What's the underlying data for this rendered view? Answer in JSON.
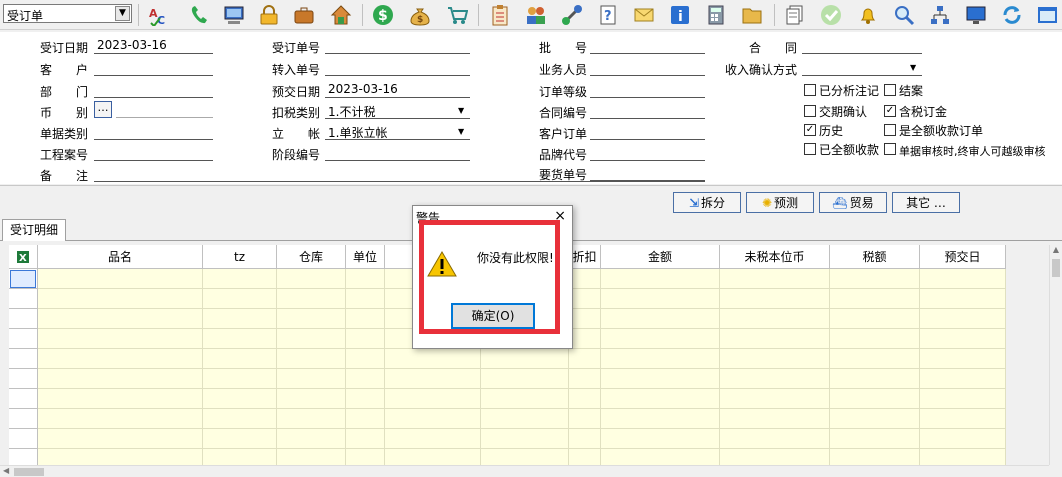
{
  "toolbar": {
    "form_select": "受订单",
    "icons": [
      "spell-check-icon",
      "phone-icon",
      "computer-icon",
      "lock-icon",
      "briefcase-icon",
      "home-icon",
      "dollar-icon",
      "money-bag-icon",
      "cart-icon",
      "clipboard-icon",
      "users-icon",
      "link-icon",
      "help-doc-icon",
      "mail-icon",
      "info-icon",
      "calculator-icon",
      "folder-icon",
      "document-icon",
      "check-icon",
      "bell-icon",
      "search-icon",
      "tree-icon",
      "monitor-icon",
      "refresh-icon",
      "window-icon"
    ]
  },
  "form": {
    "order_date_label": "受订日期",
    "order_date": "2023-03-16",
    "customer_label": "客　　户",
    "dept_label": "部　　门",
    "currency_label": "币　　别",
    "currency_btn": "…",
    "doc_type_label": "单据类别",
    "project_label": "工程案号",
    "remark_label": "备　　注",
    "order_no_label": "受订单号",
    "transfer_no_label": "转入单号",
    "delivery_date_label": "预交日期",
    "delivery_date": "2023-03-16",
    "tax_type_label": "扣税类别",
    "tax_type": "1.不计税",
    "account_label": "立　　帐",
    "account": "1.单张立帐",
    "stage_label": "阶段编号",
    "batch_label": "批　　号",
    "salesperson_label": "业务人员",
    "order_level_label": "订单等级",
    "contract_no_label": "合同编号",
    "customer_order_label": "客户订单",
    "brand_label": "品牌代号",
    "requisition_label": "要货单号",
    "contract_label": "合　　同",
    "income_label": "收入确认方式"
  },
  "checkboxes": [
    {
      "label": "已分析注记",
      "checked": false
    },
    {
      "label": "结案",
      "checked": false
    },
    {
      "label": "交期确认",
      "checked": false
    },
    {
      "label": "含税订金",
      "checked": true
    },
    {
      "label": "历史",
      "checked": true
    },
    {
      "label": "是全额收款订单",
      "checked": false
    },
    {
      "label": "已全额收款",
      "checked": false
    },
    {
      "label": "单据审核时,终审人可越级审核",
      "checked": false
    }
  ],
  "actions": {
    "split": "拆分",
    "forecast": "预测",
    "trade": "贸易",
    "other": "其它 …"
  },
  "tab": "受订明细",
  "grid": {
    "columns": [
      "品名",
      "tz",
      "仓库",
      "单位",
      "",
      "",
      "折扣",
      "金额",
      "未税本位币",
      "税额",
      "预交日"
    ]
  },
  "dialog": {
    "title": "警告",
    "message": "你没有此权限!",
    "ok": "确定(O)",
    "close": "×"
  }
}
